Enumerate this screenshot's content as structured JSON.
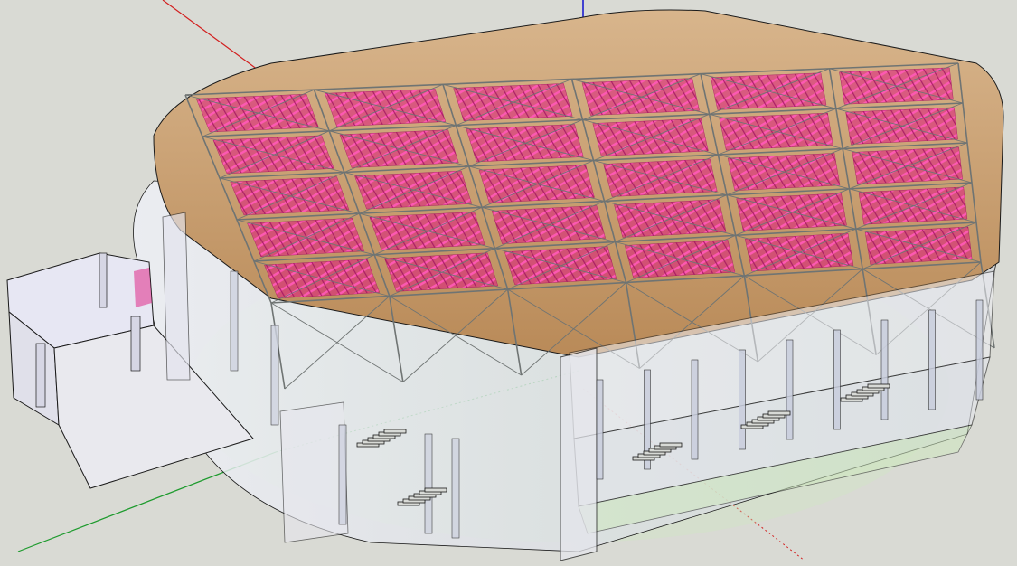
{
  "viewport": {
    "background": "#d9dad4",
    "model": {
      "roof_fill": "#cfa77c",
      "seat_color": "#e0187f",
      "truss_color": "#6f7473",
      "glass_color": "#e9ecf2",
      "floor_color": "#cfe8c0",
      "edge_color": "#1a1a1a"
    },
    "axes": {
      "red": "#d21f1f",
      "green": "#1c9a2c",
      "blue": "#1c1ccf"
    }
  }
}
